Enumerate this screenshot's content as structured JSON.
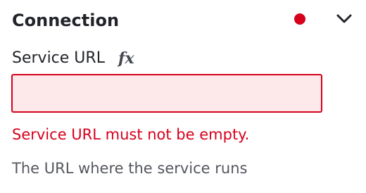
{
  "section": {
    "title": "Connection",
    "status_color": "#d6001c",
    "status": "error",
    "toggle_icon": "chevron-down-icon"
  },
  "field": {
    "label": "Service URL",
    "expression_icon_glyph": "fx",
    "value": "",
    "placeholder": "",
    "error": "Service URL must not be empty.",
    "help": "The URL where the service runs"
  },
  "colors": {
    "error": "#d6001c",
    "error_background": "#fde9ea",
    "text": "#22242a",
    "help_text": "#54575e"
  }
}
